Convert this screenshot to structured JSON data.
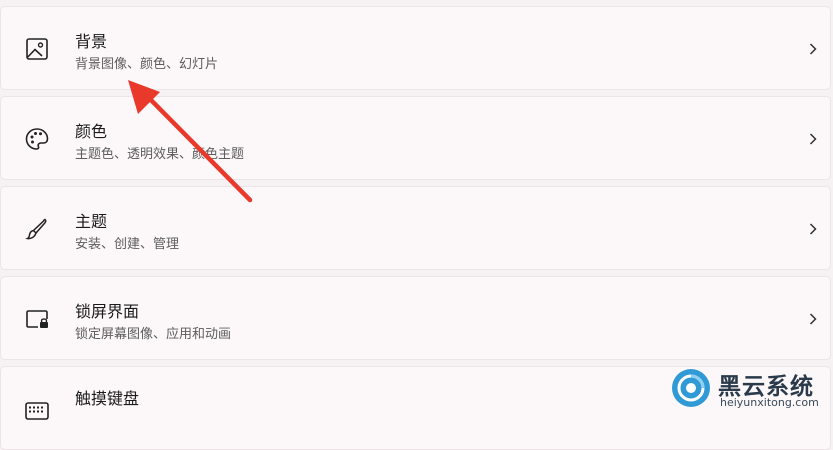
{
  "settings_items": [
    {
      "title": "背景",
      "description": "背景图像、颜色、幻灯片",
      "icon": "image-icon"
    },
    {
      "title": "颜色",
      "description": "主题色、透明效果、颜色主题",
      "icon": "palette-icon"
    },
    {
      "title": "主题",
      "description": "安装、创建、管理",
      "icon": "brush-icon"
    },
    {
      "title": "锁屏界面",
      "description": "锁定屏幕图像、应用和动画",
      "icon": "lock-screen-icon"
    },
    {
      "title": "触摸键盘",
      "description": "",
      "icon": "keyboard-icon"
    }
  ],
  "watermark": {
    "name": "黑云系统",
    "url": "heiyunxitong.com"
  },
  "colors": {
    "card_bg": "#fcf8f9",
    "page_bg": "#f6f1f3",
    "annotation_arrow": "#e8392b"
  }
}
